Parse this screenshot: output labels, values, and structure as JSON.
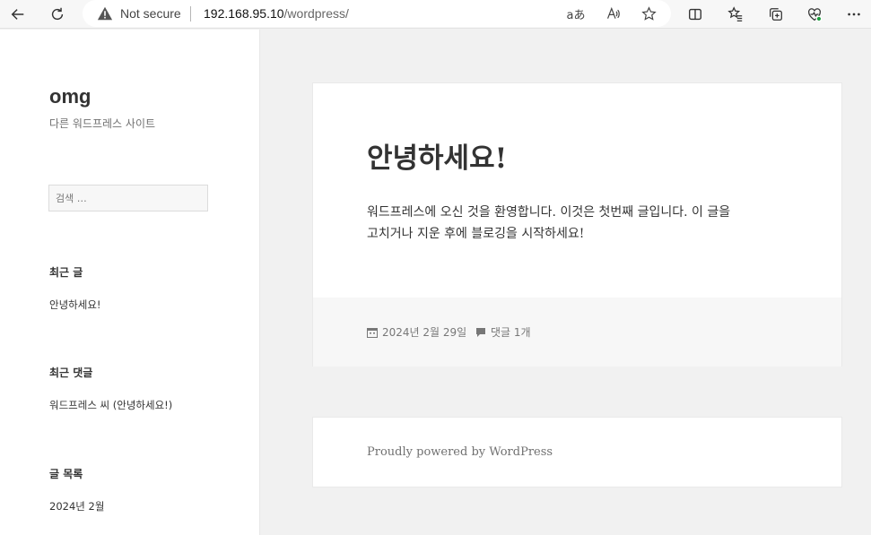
{
  "browser": {
    "security_label": "Not secure",
    "url_host": "192.168.95.10",
    "url_path": "/wordpress/",
    "read_aloud_glyph": "A",
    "translate_glyph": "aあ"
  },
  "site": {
    "title": "omg",
    "description": "다른 워드프레스 사이트"
  },
  "sidebar": {
    "search_placeholder": "검색 …",
    "recent_posts_title": "최근 글",
    "recent_post_1": "안녕하세요!",
    "recent_comments_title": "최근 댓글",
    "recent_comment_1": "워드프레스 씨 (안녕하세요!)",
    "archives_title": "글 목록",
    "archive_1": "2024년 2월"
  },
  "post": {
    "title": "안녕하세요!",
    "content_line1": "워드프레스에 오신 것을 환영합니다. 이것은 첫번째 글입니다. 이 글을",
    "content_line2": "고치거나 지운 후에 블로깅을 시작하세요!",
    "date": "2024년 2월 29일",
    "comments": "댓글 1개"
  },
  "footer": {
    "powered": "Proudly powered by WordPress"
  }
}
